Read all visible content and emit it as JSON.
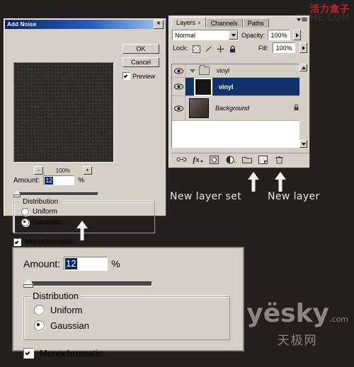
{
  "dialog": {
    "title": "Add Noise",
    "close_label": "✕",
    "ok_label": "OK",
    "cancel_label": "Cancel",
    "preview_label": "Preview",
    "preview_checked": true,
    "zoom": {
      "minus_label": "-",
      "value": "100%",
      "plus_label": "+"
    },
    "amount_label": "Amount:",
    "amount_value": "12",
    "percent_symbol": "%",
    "distribution": {
      "legend": "Distribution",
      "options": [
        "Uniform",
        "Gaussian"
      ],
      "selected": "Gaussian"
    },
    "monochromatic_label": "Monochromatic",
    "monochromatic_checked": true
  },
  "layers_panel": {
    "tabs": [
      {
        "label": "Layers",
        "close": "×",
        "active": true
      },
      {
        "label": "Channels",
        "active": false
      },
      {
        "label": "Paths",
        "active": false
      }
    ],
    "blend_mode": "Normal",
    "opacity_label": "Opacity:",
    "opacity_value": "100%",
    "lock_label": "Lock:",
    "lock_icons": [
      "transparency-lock-icon",
      "brush-lock-icon",
      "move-lock-icon",
      "all-lock-icon"
    ],
    "fill_label": "Fill:",
    "fill_value": "100%",
    "layers": [
      {
        "name": "vinyl",
        "type": "group",
        "visible": true,
        "expanded": true
      },
      {
        "name": "vinyl",
        "type": "layer",
        "visible": true,
        "selected": true
      },
      {
        "name": "Background",
        "type": "background",
        "visible": true,
        "locked": true
      }
    ],
    "bottom_icons": [
      "link-layers-icon",
      "layer-style-fx-icon",
      "layer-mask-icon",
      "adjustment-layer-icon",
      "new-layer-set-icon",
      "new-layer-icon",
      "delete-layer-icon"
    ],
    "fx_label": "fx"
  },
  "annotations": {
    "new_layer_set": "New layer set",
    "new_layer": "New layer"
  },
  "watermarks": {
    "top_cn": "活力盒子",
    "top_en": "OUHE.COM",
    "bottom_brand": "yësky",
    "bottom_tld": ".com",
    "bottom_cn": "天极网"
  },
  "colors": {
    "chrome": "#d4d0c8",
    "titlebar": "#0a246a",
    "selection": "#10316b",
    "watermark_red": "#c4212b",
    "noise": "#17120f"
  }
}
